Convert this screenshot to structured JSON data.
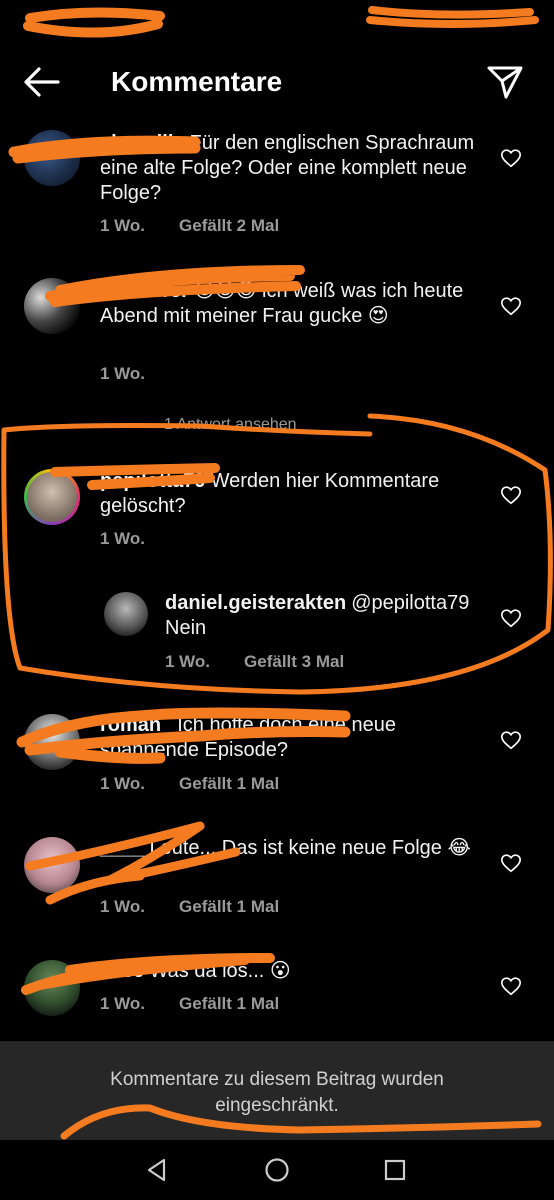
{
  "header": {
    "title": "Kommentare",
    "back_icon": "arrow-left-icon",
    "send_icon": "paper-plane-icon"
  },
  "comments": [
    {
      "username": "sky_pille",
      "text": "Für den englischen Sprachraum eine alte Folge? Oder eine komplett neue Folge?",
      "time": "1 Wo.",
      "likes": "Gefällt 2 Mal"
    },
    {
      "username": "wanderer",
      "text": "😍😍😍 ich weiß was ich heute Abend mit meiner Frau gucke 😍",
      "time": "1 Wo.",
      "likes": ""
    },
    {
      "username": "pepilotta79",
      "text": "Werden hier Kommentare gelöscht?",
      "time": "1 Wo.",
      "likes": "",
      "reply_toggle": "1 Antwort ansehen"
    },
    {
      "username": "roman_",
      "text": "Ich hoffe doch eine neue spannende Episode?",
      "time": "1 Wo.",
      "likes": "Gefällt 1 Mal"
    },
    {
      "username": "____",
      "text": "Leute... Das ist keine neue Folge 😂",
      "time": "1 Wo.",
      "likes": "Gefällt 1 Mal"
    },
    {
      "username": "1969",
      "text": "Was da los... 😮",
      "time": "1 Wo.",
      "likes": "Gefällt 1 Mal"
    }
  ],
  "reply": {
    "username": "daniel.geisterakten",
    "text": "@pepilotta79 Nein",
    "time": "1 Wo.",
    "likes": "Gefällt 3 Mal"
  },
  "footer": {
    "restricted_line1": "Kommentare zu diesem Beitrag wurden",
    "restricted_line2": "eingeschränkt."
  },
  "colors": {
    "background": "#000000",
    "annotation": "#f47b20",
    "meta": "#9a9a9a",
    "banner": "#272727"
  }
}
